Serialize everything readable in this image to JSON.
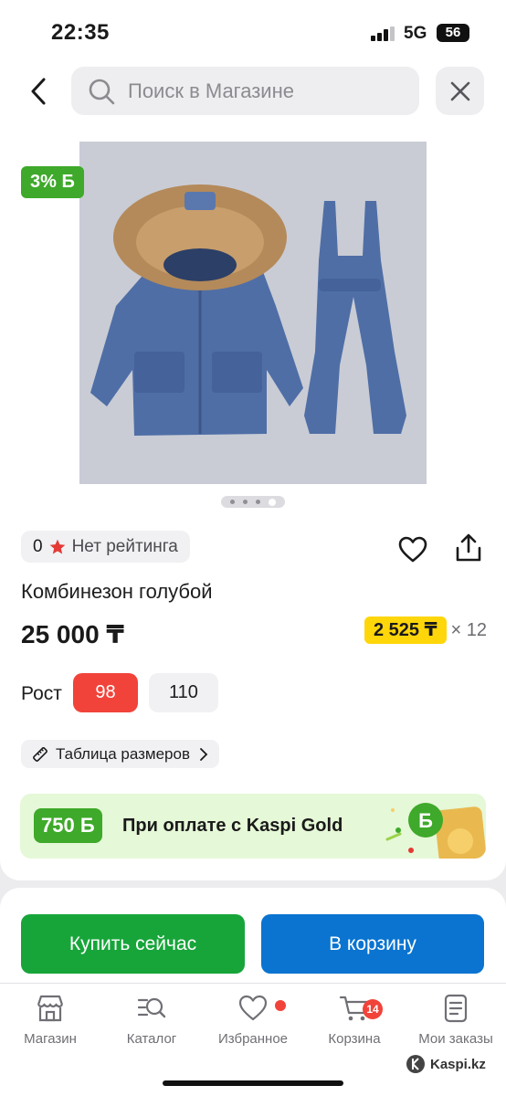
{
  "status_bar": {
    "time": "22:35",
    "network": "5G",
    "battery": "56"
  },
  "search": {
    "placeholder": "Поиск в Магазине"
  },
  "product": {
    "bonus_badge": "3% Б",
    "rating_count": "0",
    "rating_text": "Нет рейтинга",
    "title": "Комбинезон голубой",
    "price": "25 000 ₸",
    "installment_amount": "2 525 ₸",
    "installment_months": "× 12",
    "size_label": "Рост",
    "sizes": [
      {
        "label": "98",
        "selected": true
      },
      {
        "label": "110",
        "selected": false
      }
    ],
    "size_table_label": "Таблица размеров",
    "image_count": 4,
    "active_image_index": 3
  },
  "kaspi_gold": {
    "bonus": "750 Б",
    "text": "При оплате с Kaspi Gold"
  },
  "actions": {
    "buy_now": "Купить сейчас",
    "add_to_cart": "В корзину"
  },
  "tabs": [
    {
      "label": "Магазин",
      "icon": "shop-icon"
    },
    {
      "label": "Каталог",
      "icon": "catalog-search-icon"
    },
    {
      "label": "Избранное",
      "icon": "heart-icon",
      "has_dot": true
    },
    {
      "label": "Корзина",
      "icon": "cart-icon",
      "badge": "14"
    },
    {
      "label": "Мои заказы",
      "icon": "orders-icon"
    }
  ],
  "watermark": "Kaspi.kz",
  "colors": {
    "green": "#3ea92a",
    "red": "#f1433a",
    "blue": "#0a74d0",
    "buy_green": "#17a53a",
    "yellow": "#ffd60a"
  }
}
